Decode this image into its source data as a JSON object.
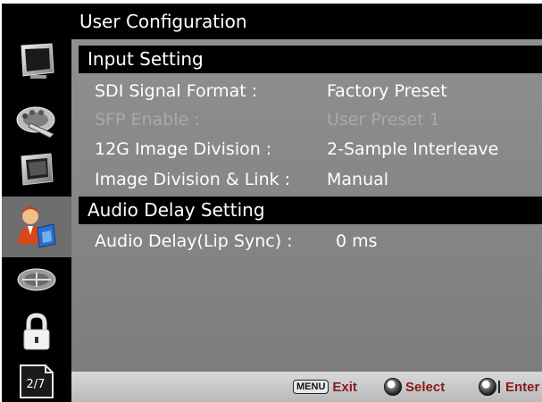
{
  "header": {
    "title": "User Configuration"
  },
  "sections": [
    {
      "title": "Input Setting",
      "rows": [
        {
          "label": "SDI Signal Format :",
          "value": "Factory Preset",
          "enabled": true
        },
        {
          "label": "SFP Enable :",
          "value": "User Preset 1",
          "enabled": false
        },
        {
          "label": "12G Image Division :",
          "value": "2-Sample Interleave",
          "enabled": true
        },
        {
          "label": "Image Division & Link :",
          "value": "Manual",
          "enabled": true
        }
      ]
    },
    {
      "title": "Audio Delay Setting",
      "rows": [
        {
          "label": "Audio Delay(Lip Sync) :",
          "value": "0 ms",
          "enabled": true
        }
      ]
    }
  ],
  "sidebar": {
    "items": [
      {
        "icon": "monitor-icon"
      },
      {
        "icon": "color-palette-icon"
      },
      {
        "icon": "screen-icon"
      },
      {
        "icon": "user-config-icon",
        "active": true
      },
      {
        "icon": "network-icon"
      },
      {
        "icon": "lock-icon"
      }
    ],
    "page_indicator": "2/7"
  },
  "footer": {
    "menu_key": "MENU",
    "exit_label": "Exit",
    "select_label": "Select",
    "enter_label": "Enter"
  },
  "colors": {
    "content_bg": "#878787",
    "section_bar": "#000000",
    "active_sidebar": "#6e6e6e",
    "footer_text": "#8a1a1a",
    "disabled_text": "#a9a9a9"
  }
}
